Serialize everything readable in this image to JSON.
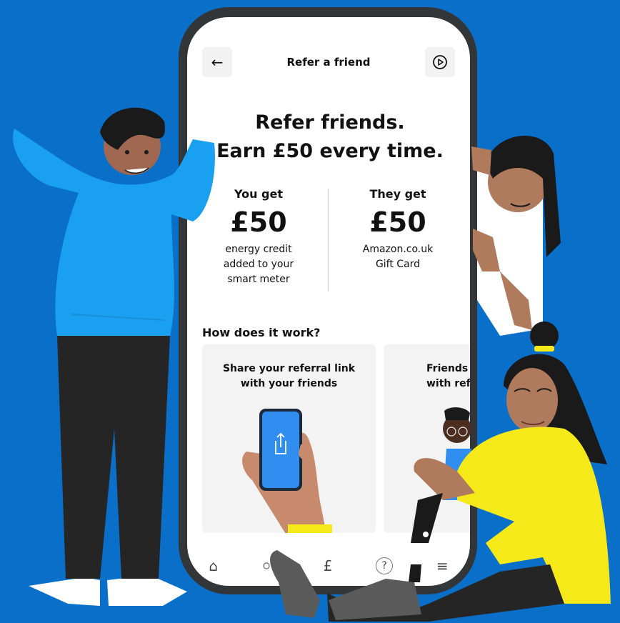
{
  "header": {
    "back_icon": "←",
    "title": "Refer a friend",
    "play_icon": "▷"
  },
  "headline": {
    "line1": "Refer friends.",
    "line2": "Earn £50 every time."
  },
  "you": {
    "label": "You get",
    "amount": "£50",
    "desc1": "energy credit",
    "desc2": "added to your",
    "desc3": "smart meter"
  },
  "they": {
    "label": "They get",
    "amount": "£50",
    "desc1": "Amazon.co.uk",
    "desc2": "Gift Card"
  },
  "how": {
    "title": "How does it work?",
    "cards": [
      {
        "line1": "Share your referral link",
        "line2": "with your friends"
      },
      {
        "line1": "Friends",
        "line2": "with refe"
      }
    ]
  },
  "nav": {
    "home": "⌂",
    "pound": "£",
    "help": "?",
    "menu": "≡"
  },
  "colors": {
    "background": "#0a6fc9",
    "phone_frame": "#333638",
    "phone_blue": "#2f8ef0",
    "sweater_blue": "#1aa0f0",
    "yellow": "#f6e91a"
  }
}
